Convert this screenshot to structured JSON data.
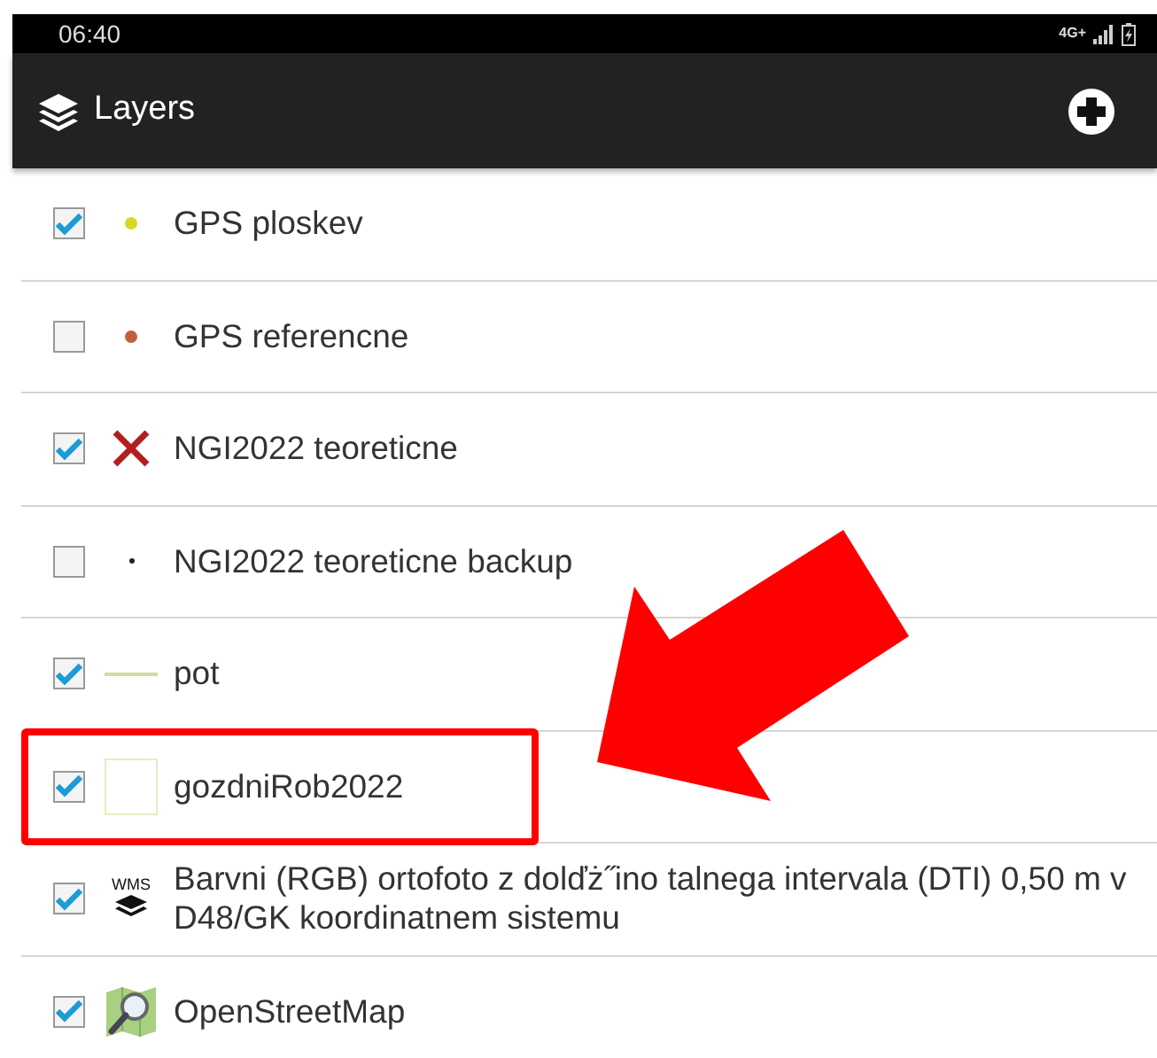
{
  "status_bar": {
    "time": "06:40",
    "network": "4G+"
  },
  "app_bar": {
    "title": "Layers"
  },
  "layers": [
    {
      "name": "GPS ploskev",
      "checked": true,
      "highlighted": false,
      "symbol": {
        "kind": "dot",
        "color": "#d8d820"
      }
    },
    {
      "name": "GPS referencne",
      "checked": false,
      "highlighted": false,
      "symbol": {
        "kind": "dot",
        "color": "#c0603a"
      }
    },
    {
      "name": "NGI2022 teoreticne",
      "checked": true,
      "highlighted": false,
      "symbol": {
        "kind": "cross",
        "color": "#b02020"
      }
    },
    {
      "name": "NGI2022 teoreticne backup",
      "checked": false,
      "highlighted": false,
      "symbol": {
        "kind": "point",
        "color": "#222222"
      }
    },
    {
      "name": "pot",
      "checked": true,
      "highlighted": false,
      "symbol": {
        "kind": "line",
        "color": "#d8d8a0"
      }
    },
    {
      "name": "gozdniRob2022",
      "checked": true,
      "highlighted": true,
      "symbol": {
        "kind": "square",
        "color": "#e8ecc0"
      }
    },
    {
      "name": "Barvni (RGB) ortofoto z dolďż˝ino talnega intervala (DTI) 0,50 m v D48/GK koordinatnem sistemu",
      "checked": true,
      "highlighted": false,
      "symbol": {
        "kind": "wms",
        "label": "WMS"
      }
    },
    {
      "name": "OpenStreetMap",
      "checked": true,
      "highlighted": false,
      "symbol": {
        "kind": "map"
      }
    }
  ],
  "pointer_arrow": true
}
